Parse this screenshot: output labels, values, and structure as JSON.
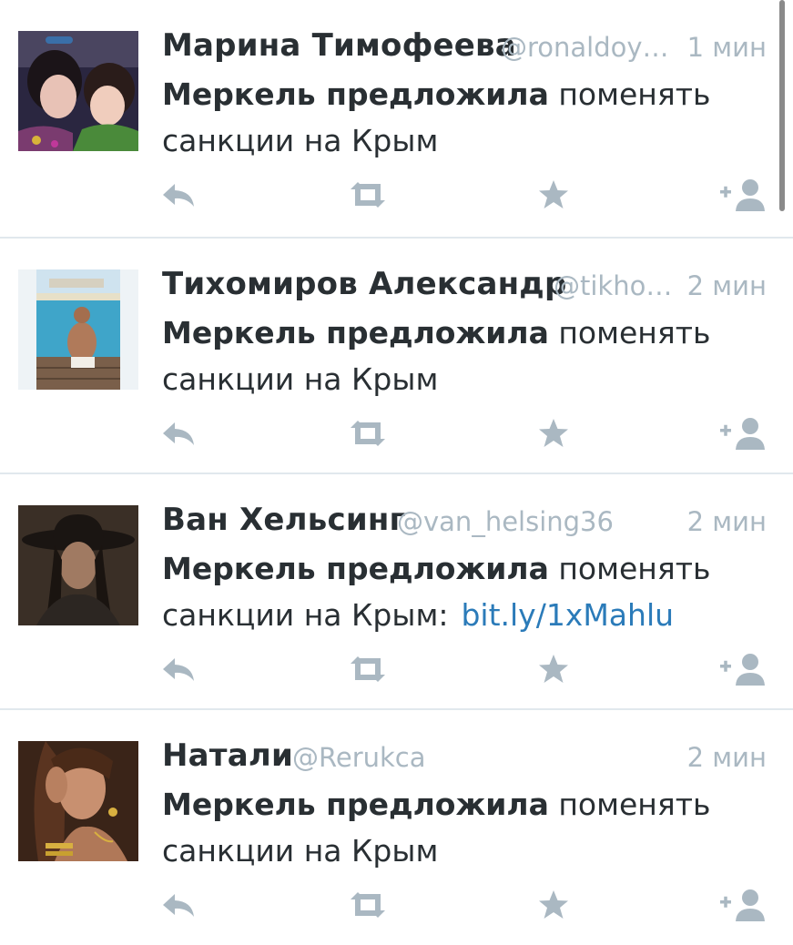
{
  "tweets": [
    {
      "name": "Марина Тимофеева",
      "handle": "@ronaldoy…",
      "time": "1 мин",
      "text_bold": "Меркель предложила",
      "text_rest": " поменять санкции на Крым",
      "link": ""
    },
    {
      "name": "Тихомиров Александр",
      "handle": "@tikho…",
      "time": "2 мин",
      "text_bold": "Меркель предложила",
      "text_rest": " поменять санкции на Крым",
      "link": ""
    },
    {
      "name": "Ван Хельсинг",
      "handle": "@van_helsing36",
      "time": "2 мин",
      "text_bold": "Меркель предложила",
      "text_rest": " поменять санкции на Крым:",
      "link": "bit.ly/1xMahlu"
    },
    {
      "name": "Натали",
      "handle": "@Rerukca",
      "time": "2 мин",
      "text_bold": "Меркель предложила",
      "text_rest": " поменять санкции на Крым",
      "link": ""
    }
  ],
  "icons": {
    "reply": "reply-icon",
    "retweet": "retweet-icon",
    "favorite": "star-icon",
    "follow": "follow-icon"
  },
  "colors": {
    "text": "#292f33",
    "muted": "#aab8c2",
    "link": "#2b7bb9",
    "action_icon": "#aab8c2"
  }
}
